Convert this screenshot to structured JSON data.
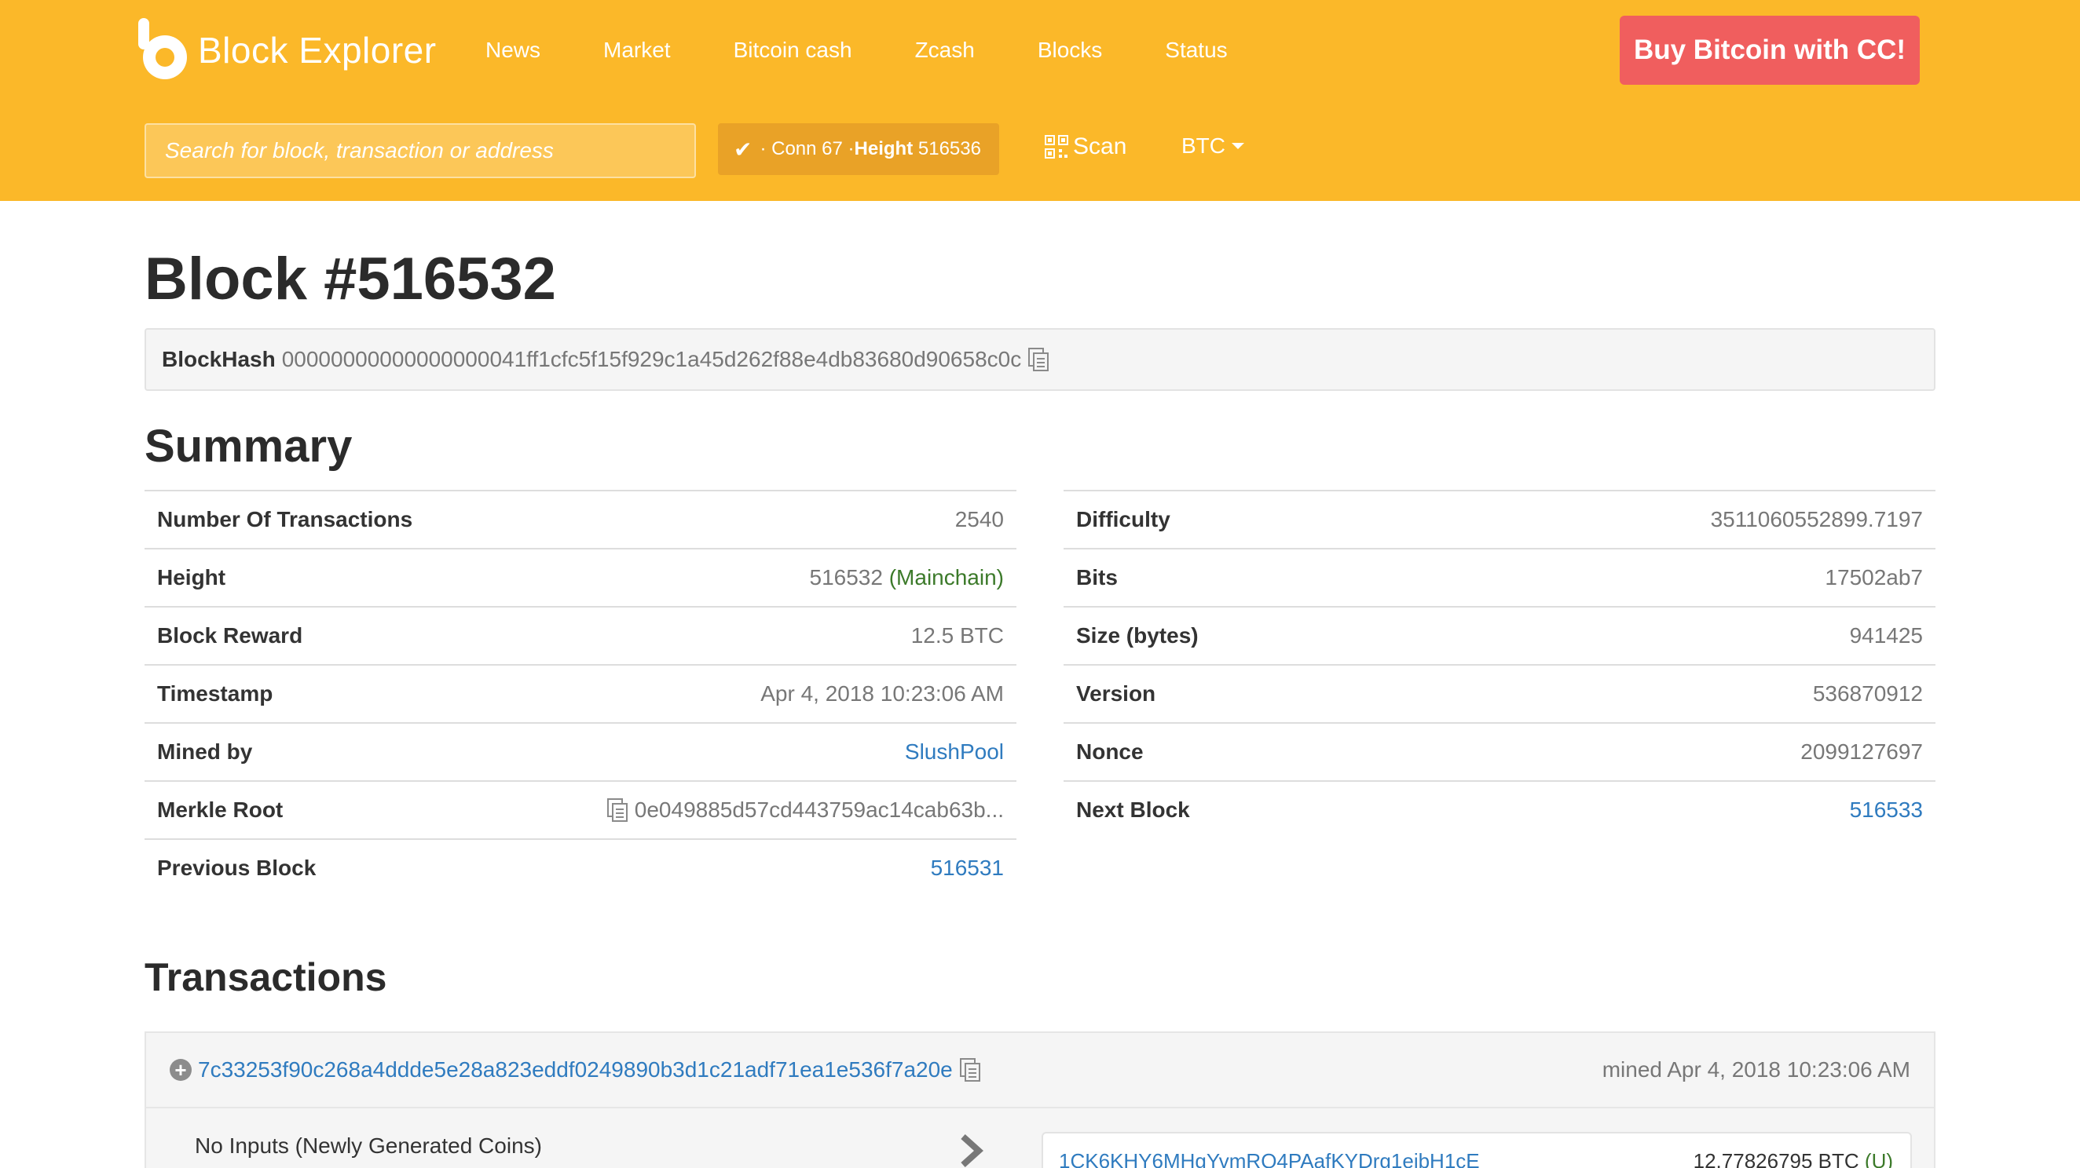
{
  "header": {
    "logo_text": "Block Explorer",
    "nav": [
      "News",
      "Market",
      "Bitcoin cash",
      "Zcash",
      "Blocks",
      "Status"
    ],
    "buy_button": "Buy Bitcoin with CC!",
    "search_placeholder": "Search for block, transaction or address",
    "conn_prefix": "· Conn 67 · ",
    "conn_height": "Height",
    "conn_height_value": "516536",
    "scan": "Scan",
    "currency": "BTC",
    "colors": {
      "header_bg": "#fbb829",
      "buy_bg": "#f05e5e"
    }
  },
  "block": {
    "title": "Block #516532",
    "hash_label": "BlockHash",
    "hash": "00000000000000000041ff1cfc5f15f929c1a45d262f88e4db83680d90658c0c"
  },
  "summary": {
    "title": "Summary",
    "left": [
      {
        "k": "Number Of Transactions",
        "v": "2540"
      },
      {
        "k": "Height",
        "v": "516532",
        "extra": "(Mainchain)"
      },
      {
        "k": "Block Reward",
        "v": "12.5 BTC"
      },
      {
        "k": "Timestamp",
        "v": "Apr 4, 2018 10:23:06 AM"
      },
      {
        "k": "Mined by",
        "v": "SlushPool"
      },
      {
        "k": "Merkle Root",
        "v": "0e049885d57cd443759ac14cab63b..."
      },
      {
        "k": "Previous Block",
        "v": "516531"
      }
    ],
    "right": [
      {
        "k": "Difficulty",
        "v": "3511060552899.7197"
      },
      {
        "k": "Bits",
        "v": "17502ab7"
      },
      {
        "k": "Size (bytes)",
        "v": "941425"
      },
      {
        "k": "Version",
        "v": "536870912"
      },
      {
        "k": "Nonce",
        "v": "2099127697"
      },
      {
        "k": "Next Block",
        "v": "516533"
      }
    ]
  },
  "transactions": {
    "title": "Transactions",
    "items": [
      {
        "txid": "7c33253f90c268a4ddde5e28a823eddf0249890b3d1c21adf71ea1e536f7a20e",
        "mined": "mined Apr 4, 2018 10:23:06 AM",
        "inputs": "No Inputs (Newly Generated Coins)",
        "output_address": "1CK6KHY6MHgYvmRQ4PAafKYDrg1ejbH1cE",
        "output_amount": "12.77826795 BTC",
        "output_status": "(U)"
      }
    ]
  }
}
